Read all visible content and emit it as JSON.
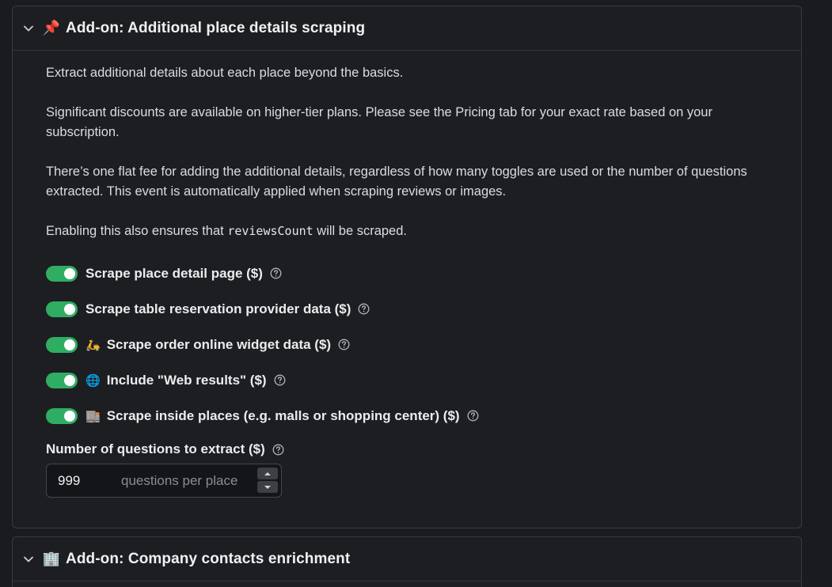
{
  "panel1": {
    "emoji": "📌",
    "title": "Add-on: Additional place details scraping",
    "paragraphs": {
      "p1": "Extract additional details about each place beyond the basics.",
      "p2": "Significant discounts are available on higher-tier plans. Please see the Pricing tab for your exact rate based on your subscription.",
      "p3": "There’s one flat fee for adding the additional details, regardless of how many toggles are used or the number of questions extracted. This event is automatically applied when scraping reviews or images.",
      "p4_before": "Enabling this also ensures that ",
      "p4_code": "reviewsCount",
      "p4_after": " will be scraped."
    },
    "toggles": [
      {
        "emoji": "",
        "label": "Scrape place detail page ($)",
        "on": true
      },
      {
        "emoji": "",
        "label": "Scrape table reservation provider data ($)",
        "on": true
      },
      {
        "emoji": "🛵",
        "label": "Scrape order online widget data ($)",
        "on": true
      },
      {
        "emoji": "🌐",
        "label": "Include \"Web results\" ($)",
        "on": true
      },
      {
        "emoji": "🏬",
        "label": "Scrape inside places (e.g. malls or shopping center) ($)",
        "on": true
      }
    ],
    "questions_field": {
      "label": "Number of questions to extract ($)",
      "value": "999",
      "unit": "questions per place"
    }
  },
  "panel2": {
    "emoji": "🏢",
    "title": "Add-on: Company contacts enrichment"
  },
  "colors": {
    "toggle_on": "#2fae63",
    "background": "#1a1b1f",
    "panel": "#1d1e22"
  }
}
